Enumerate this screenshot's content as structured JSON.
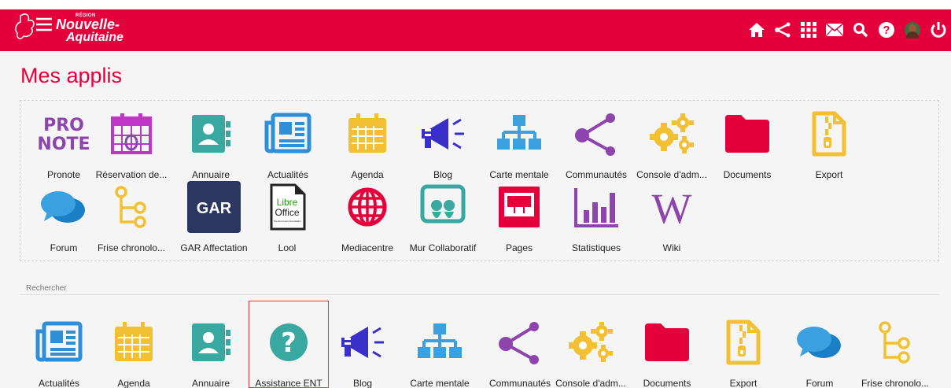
{
  "header": {
    "logo_region": "RÉGION",
    "logo_line1": "Nouvelle-",
    "logo_line2": "Aquitaine",
    "icons": [
      "home-icon",
      "share-icon",
      "apps-grid-icon",
      "mail-icon",
      "search-icon",
      "help-icon",
      "avatar",
      "power-icon"
    ]
  },
  "page_title": "Mes applis",
  "my_apps": [
    {
      "label": "Pronote",
      "icon": "pronote-icon"
    },
    {
      "label": "Réservation de...",
      "icon": "calendar-booking-icon"
    },
    {
      "label": "Annuaire",
      "icon": "directory-icon"
    },
    {
      "label": "Actualités",
      "icon": "news-icon"
    },
    {
      "label": "Agenda",
      "icon": "agenda-icon"
    },
    {
      "label": "Blog",
      "icon": "blog-icon"
    },
    {
      "label": "Carte mentale",
      "icon": "mindmap-icon"
    },
    {
      "label": "Communautés",
      "icon": "communities-icon"
    },
    {
      "label": "Console d'adm...",
      "icon": "admin-console-icon"
    },
    {
      "label": "Documents",
      "icon": "documents-icon"
    },
    {
      "label": "Export",
      "icon": "export-icon"
    },
    {
      "label": "Forum",
      "icon": "forum-icon"
    },
    {
      "label": "Frise chronolo...",
      "icon": "timeline-icon"
    },
    {
      "label": "GAR Affectation",
      "icon": "gar-icon"
    },
    {
      "label": "Lool",
      "icon": "libreoffice-icon"
    },
    {
      "label": "Mediacentre",
      "icon": "mediacentre-icon"
    },
    {
      "label": "Mur Collaboratif",
      "icon": "collaborative-wall-icon"
    },
    {
      "label": "Pages",
      "icon": "pages-icon"
    },
    {
      "label": "Statistiques",
      "icon": "statistics-icon"
    },
    {
      "label": "Wiki",
      "icon": "wiki-icon"
    }
  ],
  "gar_text": "GAR",
  "libre_text1": "Libre",
  "libre_text2": "Office",
  "libre_text3": "The Document Foundation",
  "pronote_text1": "PRO",
  "pronote_text2": "NOTE",
  "wiki_text": "W",
  "search": {
    "label": "Rechercher",
    "results": [
      {
        "label": "Actualités",
        "icon": "news-icon"
      },
      {
        "label": "Agenda",
        "icon": "agenda-icon"
      },
      {
        "label": "Annuaire",
        "icon": "directory-icon"
      },
      {
        "label": "Assistance ENT",
        "icon": "help-icon"
      },
      {
        "label": "Blog",
        "icon": "blog-icon"
      },
      {
        "label": "Carte mentale",
        "icon": "mindmap-icon"
      },
      {
        "label": "Communautés",
        "icon": "communities-icon"
      },
      {
        "label": "Console d'adm...",
        "icon": "admin-console-icon"
      },
      {
        "label": "Documents",
        "icon": "documents-icon"
      },
      {
        "label": "Export",
        "icon": "export-icon"
      },
      {
        "label": "Forum",
        "icon": "forum-icon"
      },
      {
        "label": "Frise chronolo...",
        "icon": "timeline-icon"
      }
    ]
  },
  "colors": {
    "brand": "#e4003a",
    "purple": "#8e44ad",
    "magenta": "#c034c8",
    "teal": "#38a8a0",
    "blue": "#2f8ed8",
    "yellow": "#f4c033",
    "red": "#e4003a",
    "navy": "#2d3660",
    "lightblue": "#3aa0e0"
  }
}
